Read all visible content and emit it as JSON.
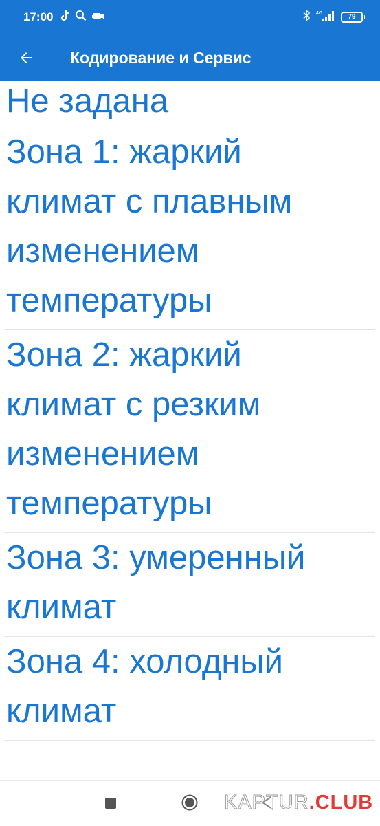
{
  "status_bar": {
    "time": "17:00",
    "network": "4G",
    "battery": "79",
    "icons": [
      "tiktok-icon",
      "search-icon",
      "car-engine-icon",
      "bluetooth-icon",
      "signal-icon",
      "battery-icon"
    ]
  },
  "app_bar": {
    "title": "Кодирование и Сервис",
    "back_icon": "arrow-back-icon"
  },
  "options": [
    {
      "lines": [
        "Не задана"
      ]
    },
    {
      "lines": [
        "Зона 1: жаркий",
        "климат с плавным",
        "изменением",
        "температуры"
      ]
    },
    {
      "lines": [
        "Зона 2: жаркий",
        "климат с резким",
        "изменением",
        "температуры"
      ]
    },
    {
      "lines": [
        "Зона 3: умеренный",
        "климат"
      ]
    },
    {
      "lines": [
        "Зона 4: холодный",
        "климат"
      ]
    }
  ],
  "nav_bar": {
    "icons": [
      "recents-icon",
      "home-icon",
      "back-icon"
    ]
  },
  "watermark": {
    "name": "KAPTUR",
    "tld": ".CLUB"
  },
  "colors": {
    "primary": "#1976d2",
    "item_text": "#1976d2",
    "divider": "#e3e3e3",
    "watermark_accent": "#e53935"
  }
}
